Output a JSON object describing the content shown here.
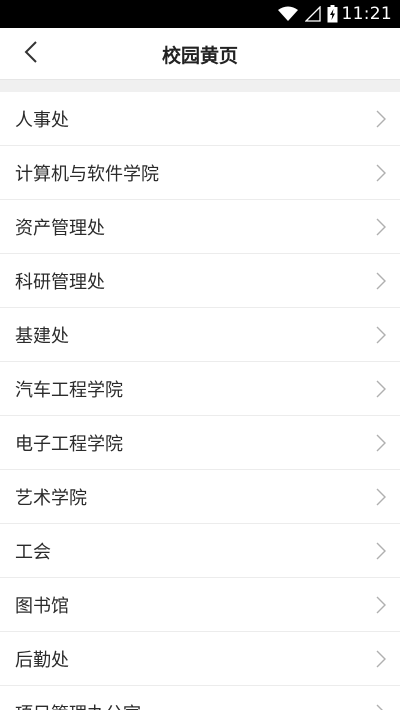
{
  "status_bar": {
    "time": "11:21",
    "icons": [
      "wifi-icon",
      "signal-icon",
      "battery-charging-icon"
    ]
  },
  "header": {
    "title": "校园黄页",
    "back_icon": "chevron-left-icon"
  },
  "directory": {
    "items": [
      {
        "label": "人事处"
      },
      {
        "label": "计算机与软件学院"
      },
      {
        "label": "资产管理处"
      },
      {
        "label": "科研管理处"
      },
      {
        "label": "基建处"
      },
      {
        "label": "汽车工程学院"
      },
      {
        "label": "电子工程学院"
      },
      {
        "label": "艺术学院"
      },
      {
        "label": "工会"
      },
      {
        "label": "图书馆"
      },
      {
        "label": "后勤处"
      },
      {
        "label": "项目管理办公室"
      }
    ]
  },
  "colors": {
    "status_bar_bg": "#000000",
    "text": "#2b2b2b",
    "chevron": "#b0b0b0",
    "divider": "#ececec",
    "band": "#f0f0f0"
  }
}
